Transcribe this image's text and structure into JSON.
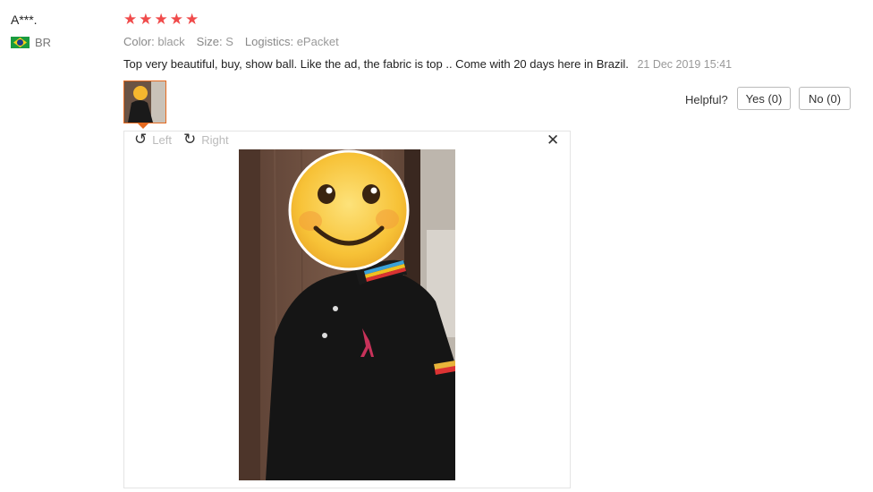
{
  "reviewer": {
    "name": "A***.",
    "country": "BR",
    "flag_icon": "brazil-flag-icon"
  },
  "rating": {
    "stars": 5,
    "max": 5,
    "color": "#f04b4b"
  },
  "attributes": [
    {
      "label": "Color:",
      "value": "black"
    },
    {
      "label": "Size:",
      "value": "S"
    },
    {
      "label": "Logistics:",
      "value": "ePacket"
    }
  ],
  "review": {
    "text": "Top very beautiful, buy, show ball. Like the ad, the fabric is top .. Come with 20 days here in Brazil.",
    "date": "21 Dec 2019 15:41"
  },
  "helpful": {
    "label": "Helpful?",
    "yes": "Yes (0)",
    "no": "No (0)"
  },
  "viewer": {
    "rotate_left": "Left",
    "rotate_right": "Right",
    "close_icon": "close-icon",
    "accent": "#e66a1f"
  }
}
